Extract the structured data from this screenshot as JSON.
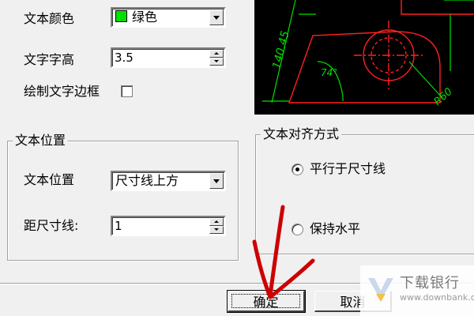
{
  "text_color": {
    "label": "文本颜色",
    "value": "绿色",
    "swatch_color": "#00e000"
  },
  "text_height": {
    "label": "文字字高",
    "value": "3.5"
  },
  "draw_frame": {
    "label": "绘制文字边框",
    "checked": false
  },
  "text_position_group": {
    "title": "文本位置",
    "position": {
      "label": "文本位置",
      "value": "尺寸线上方"
    },
    "offset": {
      "label": "距尺寸线:",
      "value": "1"
    }
  },
  "alignment_group": {
    "title": "文本对齐方式",
    "options": [
      {
        "label": "平行于尺寸线",
        "selected": true
      },
      {
        "label": "保持水平",
        "selected": false
      }
    ]
  },
  "preview": {
    "dimension_length": "140.45",
    "angle": "74°",
    "radius": "R60",
    "dimension_color": "#00e000",
    "line_color": "#ff2020"
  },
  "buttons": {
    "ok": "确定",
    "cancel": "取消"
  },
  "watermark": {
    "text": "下载银行",
    "sub": "www.downbank.cn"
  },
  "annotation": {
    "arrow_color": "#cc0000"
  }
}
